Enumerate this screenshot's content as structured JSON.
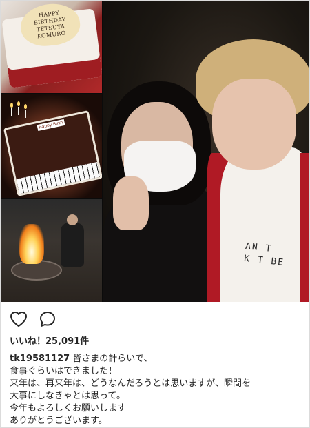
{
  "post": {
    "photo": {
      "cake_plate_lines": [
        "HAPPY",
        "BIRTHDAY",
        "TETSUYA",
        "KOMURO"
      ],
      "cake_tag": "Happy Birth",
      "shirt_print_lines": [
        "AN T",
        "K T BE"
      ]
    },
    "actions": {
      "like_icon": "heart-outline-icon",
      "comment_icon": "speech-bubble-icon"
    },
    "likes": {
      "text": "いいね！25,091件"
    },
    "caption": {
      "username": "tk19581127",
      "lines": [
        "皆さまの計らいで、",
        "食事ぐらいはできました！",
        "来年は、再来年は、どうなんだろうとは思いますが、瞬間を",
        "大事にしなきゃとは思って。",
        "今年もよろしくお願いします",
        "ありがとうございます。"
      ]
    }
  }
}
